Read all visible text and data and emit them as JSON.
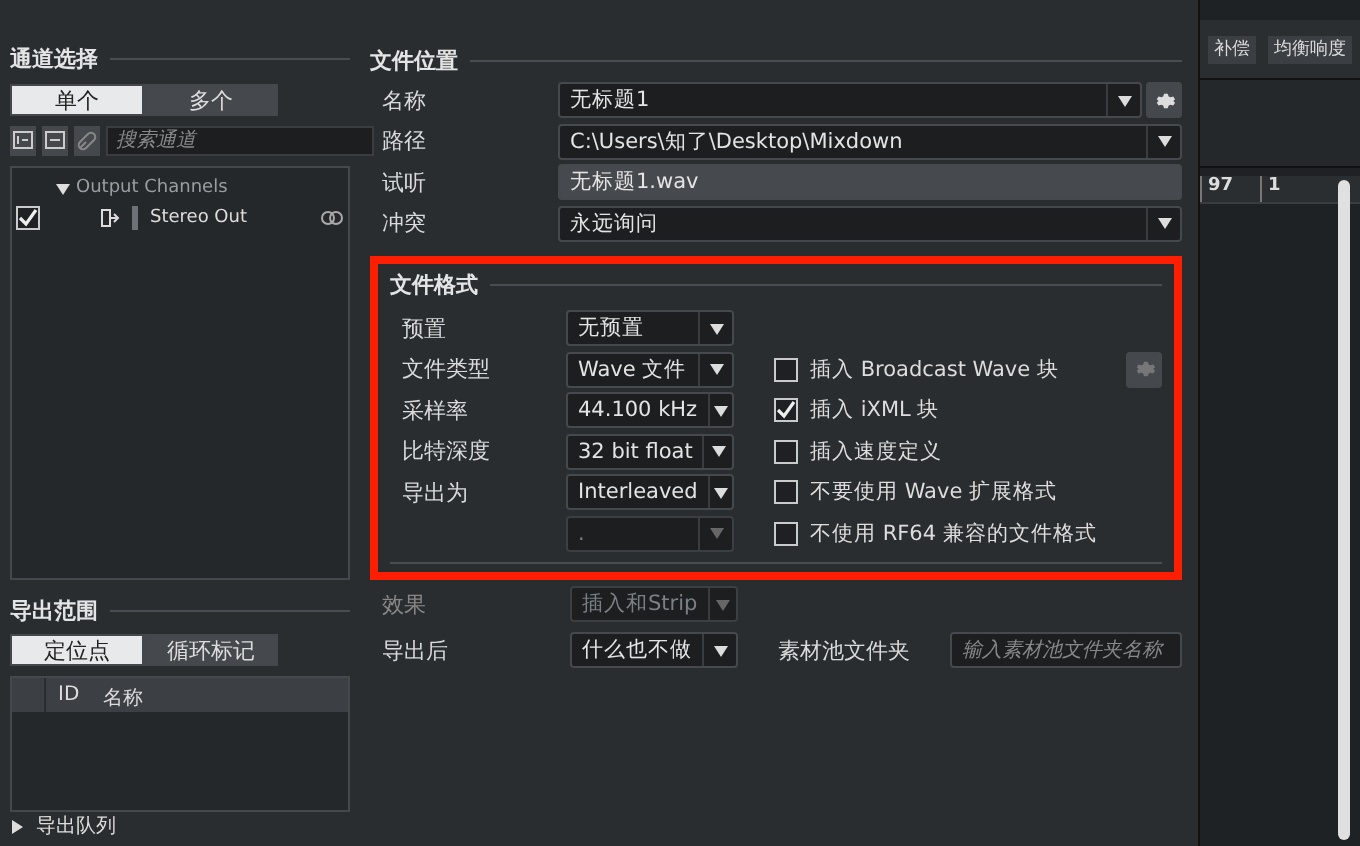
{
  "channel_selection": {
    "title": "通道选择",
    "tabs": [
      {
        "label": "单个",
        "selected": true
      },
      {
        "label": "多个",
        "selected": false
      }
    ],
    "search": {
      "placeholder": "搜索通道"
    },
    "tree": [
      {
        "label": "Output Channels",
        "expanded": true,
        "children": [
          {
            "label": "Stereo Out",
            "checked": true
          }
        ]
      }
    ]
  },
  "export_range": {
    "title": "导出范围",
    "tabs": [
      {
        "label": "定位点",
        "selected": true
      },
      {
        "label": "循环标记",
        "selected": false
      }
    ],
    "table": {
      "columns": [
        "ID",
        "名称"
      ]
    }
  },
  "export_queue": {
    "label": "导出队列",
    "expanded": false
  },
  "file_location": {
    "title": "文件位置",
    "rows": [
      {
        "label": "名称",
        "kind": "combo",
        "value": "无标题1",
        "gear": true
      },
      {
        "label": "路径",
        "kind": "combo",
        "value": "C:\\Users\\知了\\Desktop\\Mixdown",
        "gear": false
      },
      {
        "label": "试听",
        "kind": "readonly",
        "value": "无标题1.wav",
        "gear": false
      },
      {
        "label": "冲突",
        "kind": "combo",
        "value": "永远询问",
        "gear": false
      }
    ]
  },
  "file_format": {
    "title": "文件格式",
    "fields": [
      {
        "label": "预置",
        "value": "无预置",
        "disabled": false
      },
      {
        "label": "文件类型",
        "value": "Wave 文件",
        "disabled": false
      },
      {
        "label": "采样率",
        "value": "44.100 kHz",
        "disabled": false
      },
      {
        "label": "比特深度",
        "value": "32 bit float",
        "disabled": false
      },
      {
        "label": "导出为",
        "value": "Interleaved",
        "disabled": false
      },
      {
        "value": ".",
        "disabled": true
      }
    ],
    "options": [
      {
        "label": "插入 Broadcast Wave 块",
        "checked": false
      },
      {
        "label": "插入 iXML 块",
        "checked": true
      },
      {
        "label": "插入速度定义",
        "checked": false
      },
      {
        "label": "不要使用 Wave 扩展格式",
        "checked": false
      },
      {
        "label": "不使用 RF64 兼容的文件格式",
        "checked": false
      }
    ]
  },
  "effects": {
    "label": "效果",
    "value": "插入和Strip",
    "disabled": true
  },
  "after_export": {
    "label": "导出后",
    "value": "什么也不做",
    "disabled": false
  },
  "pool_folder": {
    "label": "素材池文件夹",
    "placeholder": "输入素材池文件夹名称"
  },
  "background_app": {
    "buttons": [
      "补偿",
      "均衡响度"
    ],
    "ruler": [
      "97",
      "1"
    ]
  }
}
